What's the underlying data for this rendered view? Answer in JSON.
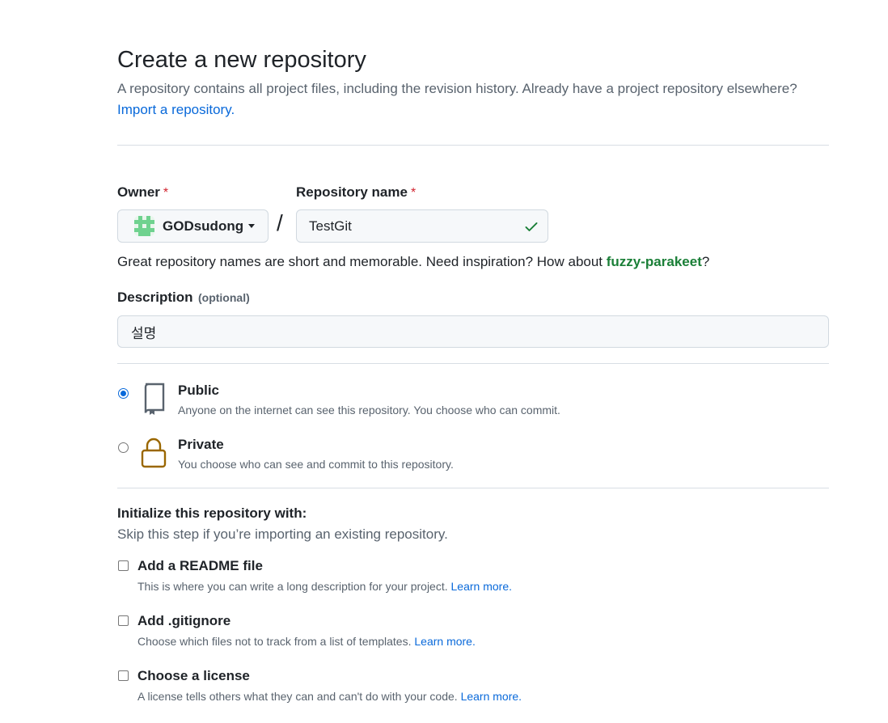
{
  "header": {
    "title": "Create a new repository",
    "subtitle": "A repository contains all project files, including the revision history. Already have a project repository elsewhere?",
    "import_link": "Import a repository."
  },
  "owner": {
    "label": "Owner",
    "required_mark": "*",
    "value": "GODsudong",
    "avatar_icon": "identicon-avatar"
  },
  "separator": "/",
  "repo_name": {
    "label": "Repository name",
    "required_mark": "*",
    "value": "TestGit",
    "valid_icon": "check-icon"
  },
  "name_hint": {
    "text_before": "Great repository names are short and memorable. Need inspiration? How about ",
    "suggestion": "fuzzy-parakeet",
    "text_after": "?"
  },
  "description": {
    "label": "Description",
    "optional": "(optional)",
    "value": "설명"
  },
  "visibility": {
    "selected": "public",
    "options": [
      {
        "key": "public",
        "title": "Public",
        "desc": "Anyone on the internet can see this repository. You choose who can commit.",
        "icon": "repo-book-icon"
      },
      {
        "key": "private",
        "title": "Private",
        "desc": "You choose who can see and commit to this repository.",
        "icon": "lock-icon"
      }
    ]
  },
  "initialize": {
    "title": "Initialize this repository with:",
    "subtitle": "Skip this step if you’re importing an existing repository.",
    "options": [
      {
        "label": "Add a README file",
        "desc": "This is where you can write a long description for your project.",
        "link": "Learn more.",
        "checked": false
      },
      {
        "label": "Add .gitignore",
        "desc": "Choose which files not to track from a list of templates.",
        "link": "Learn more.",
        "checked": false
      },
      {
        "label": "Choose a license",
        "desc": "A license tells others what they can and can't do with your code.",
        "link": "Learn more.",
        "checked": false
      }
    ]
  },
  "colors": {
    "accent": "#0969da",
    "success": "#1a7f37",
    "required": "#d1242f",
    "lock": "#9a6700"
  }
}
